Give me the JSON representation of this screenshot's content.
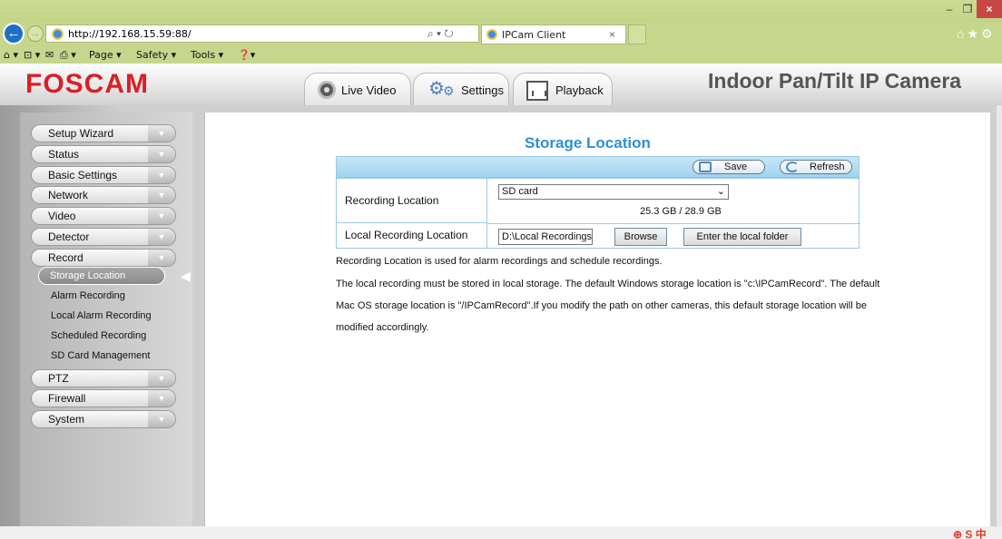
{
  "browser": {
    "url": "http://192.168.15.59:88/",
    "addr_tools": "⌕ ▾ ↻",
    "tab_title": "IPCam Client",
    "tab_close": "×",
    "win_min": "–",
    "win_max": "❐",
    "win_close": "×",
    "right_icons": "⌂★⚙",
    "cmdbar": {
      "home": "⌂ ▾",
      "feeds": "⊡ ▾",
      "mail": "✉",
      "print": "⎙ ▾",
      "page": "Page ▾",
      "safety": "Safety ▾",
      "tools": "Tools ▾",
      "help": "❓▾"
    }
  },
  "header": {
    "logo": "FOSCAM",
    "title": "Indoor Pan/Tilt IP Camera",
    "tabs": [
      {
        "label": "Live Video"
      },
      {
        "label": "Settings"
      },
      {
        "label": "Playback"
      }
    ]
  },
  "sidebar": {
    "items": [
      {
        "label": "Setup Wizard"
      },
      {
        "label": "Status"
      },
      {
        "label": "Basic Settings"
      },
      {
        "label": "Network"
      },
      {
        "label": "Video"
      },
      {
        "label": "Detector"
      },
      {
        "label": "Record"
      },
      {
        "label": "PTZ"
      },
      {
        "label": "Firewall"
      },
      {
        "label": "System"
      }
    ],
    "record_subitems": [
      {
        "label": "Storage Location"
      },
      {
        "label": "Alarm Recording"
      },
      {
        "label": "Local Alarm Recording"
      },
      {
        "label": "Scheduled Recording"
      },
      {
        "label": "SD Card Management"
      }
    ],
    "chevron": "▼"
  },
  "panel": {
    "title": "Storage Location",
    "save_label": "Save",
    "refresh_label": "Refresh",
    "recording_location_label": "Recording Location",
    "recording_location_value": "SD card",
    "capacity": "25.3 GB / 28.9 GB",
    "local_recording_label": "Local Recording Location",
    "local_path_value": "D:\\Local Recordings",
    "browse_label": "Browse",
    "enter_folder_label": "Enter the local folder",
    "desc_lines": [
      "Recording Location is used for alarm recordings and schedule recordings.",
      "The local recording must be stored in local storage. The default Windows storage location is \"c:\\IPCamRecord\". The default",
      "Mac OS storage location is \"/IPCamRecord\".If you modify the path on other cameras, this default storage location will be",
      "modified accordingly."
    ]
  },
  "statusbar": {
    "icons": "⊕ S 中"
  }
}
